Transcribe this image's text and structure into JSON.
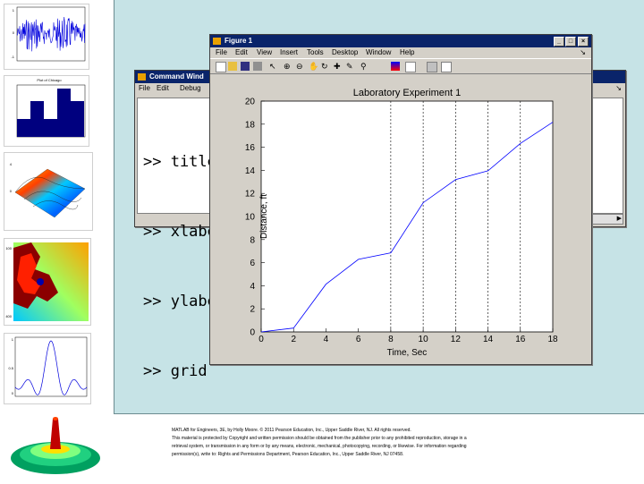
{
  "command_window": {
    "title": "Command Wind",
    "menu": [
      "File",
      "Edit",
      "Debug"
    ],
    "lines": [
      ">> title",
      ">> xlabe",
      ">> ylabe",
      ">> grid"
    ]
  },
  "figure": {
    "title": "Figure 1",
    "menu": [
      "File",
      "Edit",
      "View",
      "Insert",
      "Tools",
      "Desktop",
      "Window",
      "Help"
    ],
    "controls": [
      "_",
      "□",
      "×"
    ]
  },
  "chart_data": {
    "type": "line",
    "title": "Laboratory Experiment 1",
    "xlabel": "Time, Sec",
    "ylabel": "Distance, ft",
    "x": [
      0,
      2,
      4,
      6,
      8,
      10,
      12,
      14,
      16,
      18
    ],
    "y": [
      0,
      0.33,
      4.13,
      6.29,
      6.85,
      11.19,
      13.19,
      13.96,
      16.33,
      18.17
    ],
    "xlim": [
      0,
      18
    ],
    "ylim": [
      0,
      20
    ],
    "xticks": [
      "0",
      "2",
      "4",
      "6",
      "8",
      "10",
      "12",
      "14",
      "16",
      "18"
    ],
    "yticks": [
      "0",
      "2",
      "4",
      "6",
      "8",
      "10",
      "12",
      "14",
      "16",
      "18",
      "20"
    ],
    "grid": true,
    "grid_from_x": 8,
    "color": "#0000ff"
  },
  "thumbs": {
    "signal": {
      "xticks": [
        "0",
        "1",
        "2",
        "3",
        "4",
        "5",
        "6"
      ],
      "yticks": [
        "1",
        "0.5",
        "0",
        "-0.5",
        "-1"
      ]
    },
    "bars": {
      "title": "Plot of Chicago",
      "values": [
        1,
        2,
        1,
        3,
        2
      ]
    },
    "surface": {
      "yticks": [
        "4",
        "2",
        "0",
        "-2"
      ]
    },
    "fractal": {
      "yticks": [
        "100",
        "200",
        "300",
        "400"
      ]
    },
    "sinc": {
      "yticks": [
        "1",
        "0.5",
        "0"
      ]
    }
  },
  "caption": {
    "line1": "MATLAB for Engineers, 3E, by Holly Moore. © 2011 Pearson Education, Inc., Upper Saddle River, NJ. All rights reserved.",
    "line2": "This material is protected by Copyright and written permission should be obtained from the publisher prior to any prohibited reproduction, storage in a",
    "line3": "retrieval system, or transmission in any form or by any means, electronic, mechanical, photocopying, recording, or likewise. For information regarding",
    "line4": "permission(s), write to: Rights and Permissions Department, Pearson Education, Inc., Upper Saddle River, NJ 07458."
  }
}
